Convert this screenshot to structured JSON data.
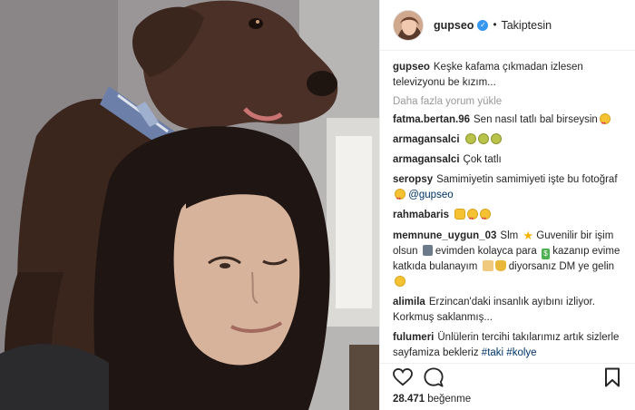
{
  "header": {
    "username": "gupseo",
    "verified_icon": "verified-badge-icon",
    "separator": "•",
    "follow_status": "Takiptesin"
  },
  "caption": {
    "username": "gupseo",
    "text": "Keşke kafama çıkmadan izlesen televizyonu be kızım..."
  },
  "load_more_label": "Daha fazla yorum yükle",
  "comments": [
    {
      "username": "fatma.bertan.96",
      "text": "Sen nasıl tatlı bal birseysin",
      "emojis": [
        "heart-eyes-emoji"
      ]
    },
    {
      "username": "armagansalci",
      "text": "",
      "emojis": [
        "sick-emoji",
        "sick-emoji",
        "sick-emoji"
      ]
    },
    {
      "username": "armagansalci",
      "text": "Çok tatlı",
      "emojis": []
    },
    {
      "username": "seropsy",
      "text": "Samimiyetin samimiyeti işte bu fotoğraf",
      "mention": "@gupseo",
      "emojis": [
        "heart-eyes-emoji"
      ]
    },
    {
      "username": "rahmabaris",
      "text": "",
      "emojis": [
        "ok-hand-emoji",
        "heart-eyes-emoji",
        "heart-eyes-emoji"
      ]
    },
    {
      "username": "memnune_uygun_03",
      "text_parts": [
        "Slm",
        "Guvenilir bir işim olsun",
        "evimden kolayca para",
        "kazanıp evime katkıda bulanayım",
        "diyorsanız DM ye gelin"
      ],
      "emojis": [
        "star-emoji",
        "speaker-emoji",
        "money-emoji",
        "house-emoji",
        "money-bag-emoji",
        "smirk-emoji"
      ]
    },
    {
      "username": "alimila",
      "text": "Erzincan'daki insanlık ayıbını izliyor. Korkmuş saklanmış...",
      "emojis": []
    },
    {
      "username": "fulumeri",
      "text": "Ünlülerin tercihi takılarımız artık sizlerle sayfamiza bekleriz",
      "tags": [
        "#taki",
        "#kolye"
      ],
      "emojis": []
    }
  ],
  "actions": {
    "like_icon": "heart-icon",
    "comment_icon": "comment-icon",
    "save_icon": "bookmark-icon"
  },
  "likes": {
    "count": "28.471",
    "label": "beğenme"
  },
  "colors": {
    "link": "#003569",
    "verified": "#3897f0",
    "muted": "#999999",
    "border": "#efefef"
  }
}
